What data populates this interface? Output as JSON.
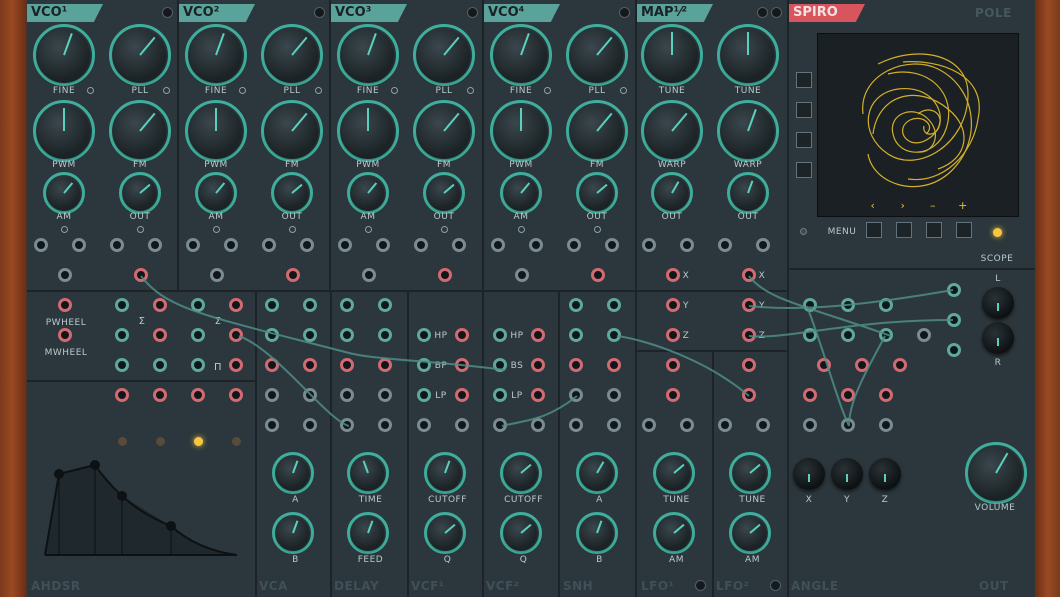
{
  "modules": {
    "vco1": {
      "title": "VCO¹"
    },
    "vco2": {
      "title": "VCO²"
    },
    "vco3": {
      "title": "VCO³"
    },
    "vco4": {
      "title": "VCO⁴"
    },
    "map": {
      "title": "MAP¹⁄²"
    },
    "spiro": {
      "title": "SPIRO"
    },
    "pole": {
      "title": "POLE"
    }
  },
  "vco_labels": {
    "fine": "FINE",
    "pll": "PLL",
    "pwm": "PWM",
    "fm": "FM",
    "am": "AM",
    "out": "OUT"
  },
  "map_labels": {
    "tune": "TUNE",
    "warp": "WARP",
    "out": "OUT",
    "x": "X",
    "y": "Y",
    "z": "Z"
  },
  "spiro": {
    "prev": "‹",
    "next": "›",
    "minus": "–",
    "plus": "+",
    "menu": "MENU",
    "scope": "SCOPE"
  },
  "mixer": {
    "pwheel": "PWHEEL",
    "mwheel": "MWHEEL",
    "sigma": "Σ",
    "pi": "Π"
  },
  "filter": {
    "hp": "HP",
    "bp": "BP",
    "lp": "LP",
    "bs": "BS"
  },
  "bottom": {
    "a": "A",
    "b": "B",
    "time": "TIME",
    "feed": "FEED",
    "cutoff": "CUTOFF",
    "q": "Q",
    "tune": "TUNE",
    "am": "AM",
    "x": "X",
    "y": "Y",
    "z": "Z",
    "volume": "VOLUME",
    "l": "L",
    "r": "R"
  },
  "footers": {
    "ahdsr": "AHDSR",
    "vca": "VCA",
    "delay": "DELAY",
    "vcf1": "VCF¹",
    "vcf2": "VCF²",
    "snh": "SNH",
    "lfo1": "LFO¹",
    "lfo2": "LFO²",
    "angle": "ANGLE",
    "out": "OUT"
  },
  "colors": {
    "teal": "#3fae9c",
    "pink": "#d26a73",
    "amber": "#f7c740",
    "panel": "#2b373c"
  }
}
